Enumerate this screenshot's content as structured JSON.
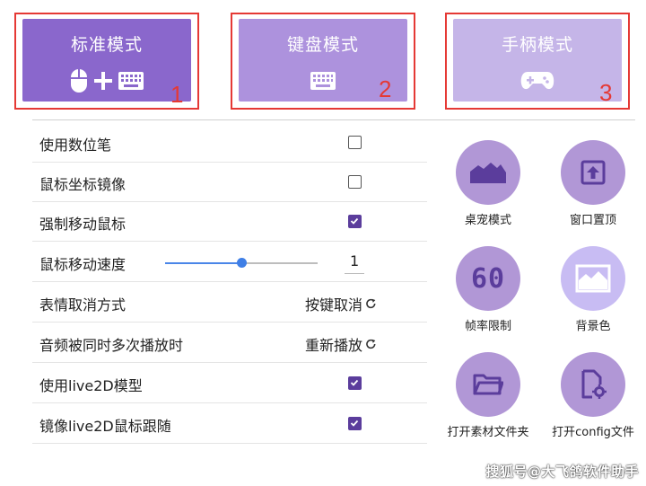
{
  "modes": [
    {
      "title": "标准模式",
      "number": "1",
      "icons": [
        "mouse-icon",
        "plus-icon",
        "keyboard-icon"
      ],
      "color": "#8a67cc"
    },
    {
      "title": "键盘模式",
      "number": "2",
      "icons": [
        "keyboard-icon"
      ],
      "color": "#ad92dd"
    },
    {
      "title": "手柄模式",
      "number": "3",
      "icons": [
        "gamepad-icon"
      ],
      "color": "#c5b5e8"
    }
  ],
  "settings": [
    {
      "label": "使用数位笔",
      "control": "checkbox",
      "checked": false
    },
    {
      "label": "鼠标坐标镜像",
      "control": "checkbox",
      "checked": false
    },
    {
      "label": "强制移动鼠标",
      "control": "checkbox",
      "checked": true
    },
    {
      "label": "鼠标移动速度",
      "control": "slider",
      "value": "1",
      "fraction": 0.5
    },
    {
      "label": "表情取消方式",
      "control": "cycle",
      "value": "按键取消"
    },
    {
      "label": "音频被同时多次播放时",
      "control": "cycle",
      "value": "重新播放"
    },
    {
      "label": "使用live2D模型",
      "control": "checkbox",
      "checked": true
    },
    {
      "label": "镜像live2D鼠标跟随",
      "control": "checkbox",
      "checked": true
    }
  ],
  "tools": [
    {
      "label": "桌宠模式",
      "icon": "desktop-pet-icon"
    },
    {
      "label": "窗口置顶",
      "icon": "window-top-icon"
    },
    {
      "label": "帧率限制",
      "icon": "fps-icon",
      "icon_text": "60"
    },
    {
      "label": "背景色",
      "icon": "background-image-icon"
    },
    {
      "label": "打开素材文件夹",
      "icon": "folder-icon"
    },
    {
      "label": "打开config文件",
      "icon": "config-file-icon"
    }
  ],
  "colors": {
    "accent": "#5b3d9c",
    "circle": "#b197d6",
    "circle_light": "#c8bcf3",
    "highlight": "#e53935"
  },
  "watermark": "搜狐号@大飞鸽软件助手"
}
